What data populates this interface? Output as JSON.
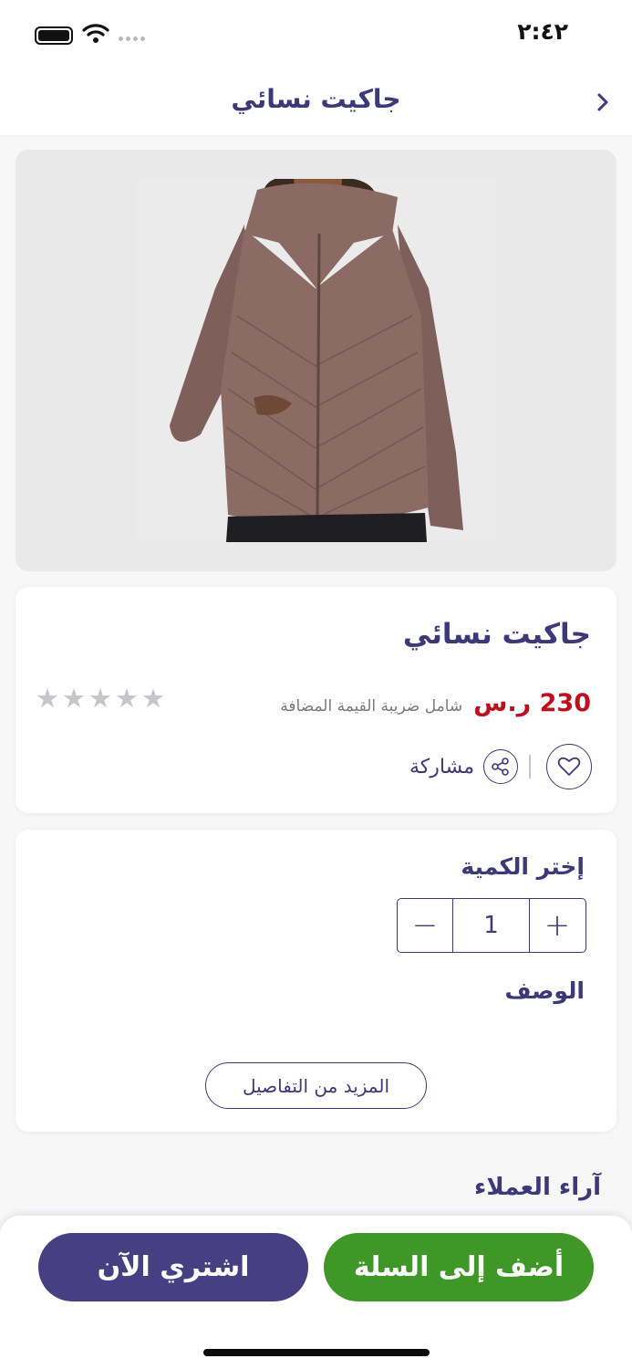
{
  "status_bar": {
    "time": "٢:٤٢"
  },
  "header": {
    "title": "جاكيت نسائي"
  },
  "product": {
    "name": "جاكيت نسائي",
    "price": "230 ر.س",
    "vat_note": "شامل ضريبة القيمة المضافة",
    "rating": 0,
    "rating_max": 5,
    "share_label": "مشاركة",
    "image_icon": "product-photo-jacket"
  },
  "quantity": {
    "title": "إختر الكمية",
    "value": "1",
    "minus": "−",
    "plus": "+"
  },
  "description": {
    "title": "الوصف",
    "more_label": "المزيد من التفاصيل"
  },
  "reviews": {
    "title": "آراء العملاء"
  },
  "actions": {
    "buy_now": "اشتري الآن",
    "add_to_cart": "أضف إلى السلة"
  },
  "colors": {
    "primary": "#463f82",
    "cart_green": "#3f9727",
    "price_red": "#c10e1f",
    "star_gray": "#c5c6c9"
  }
}
